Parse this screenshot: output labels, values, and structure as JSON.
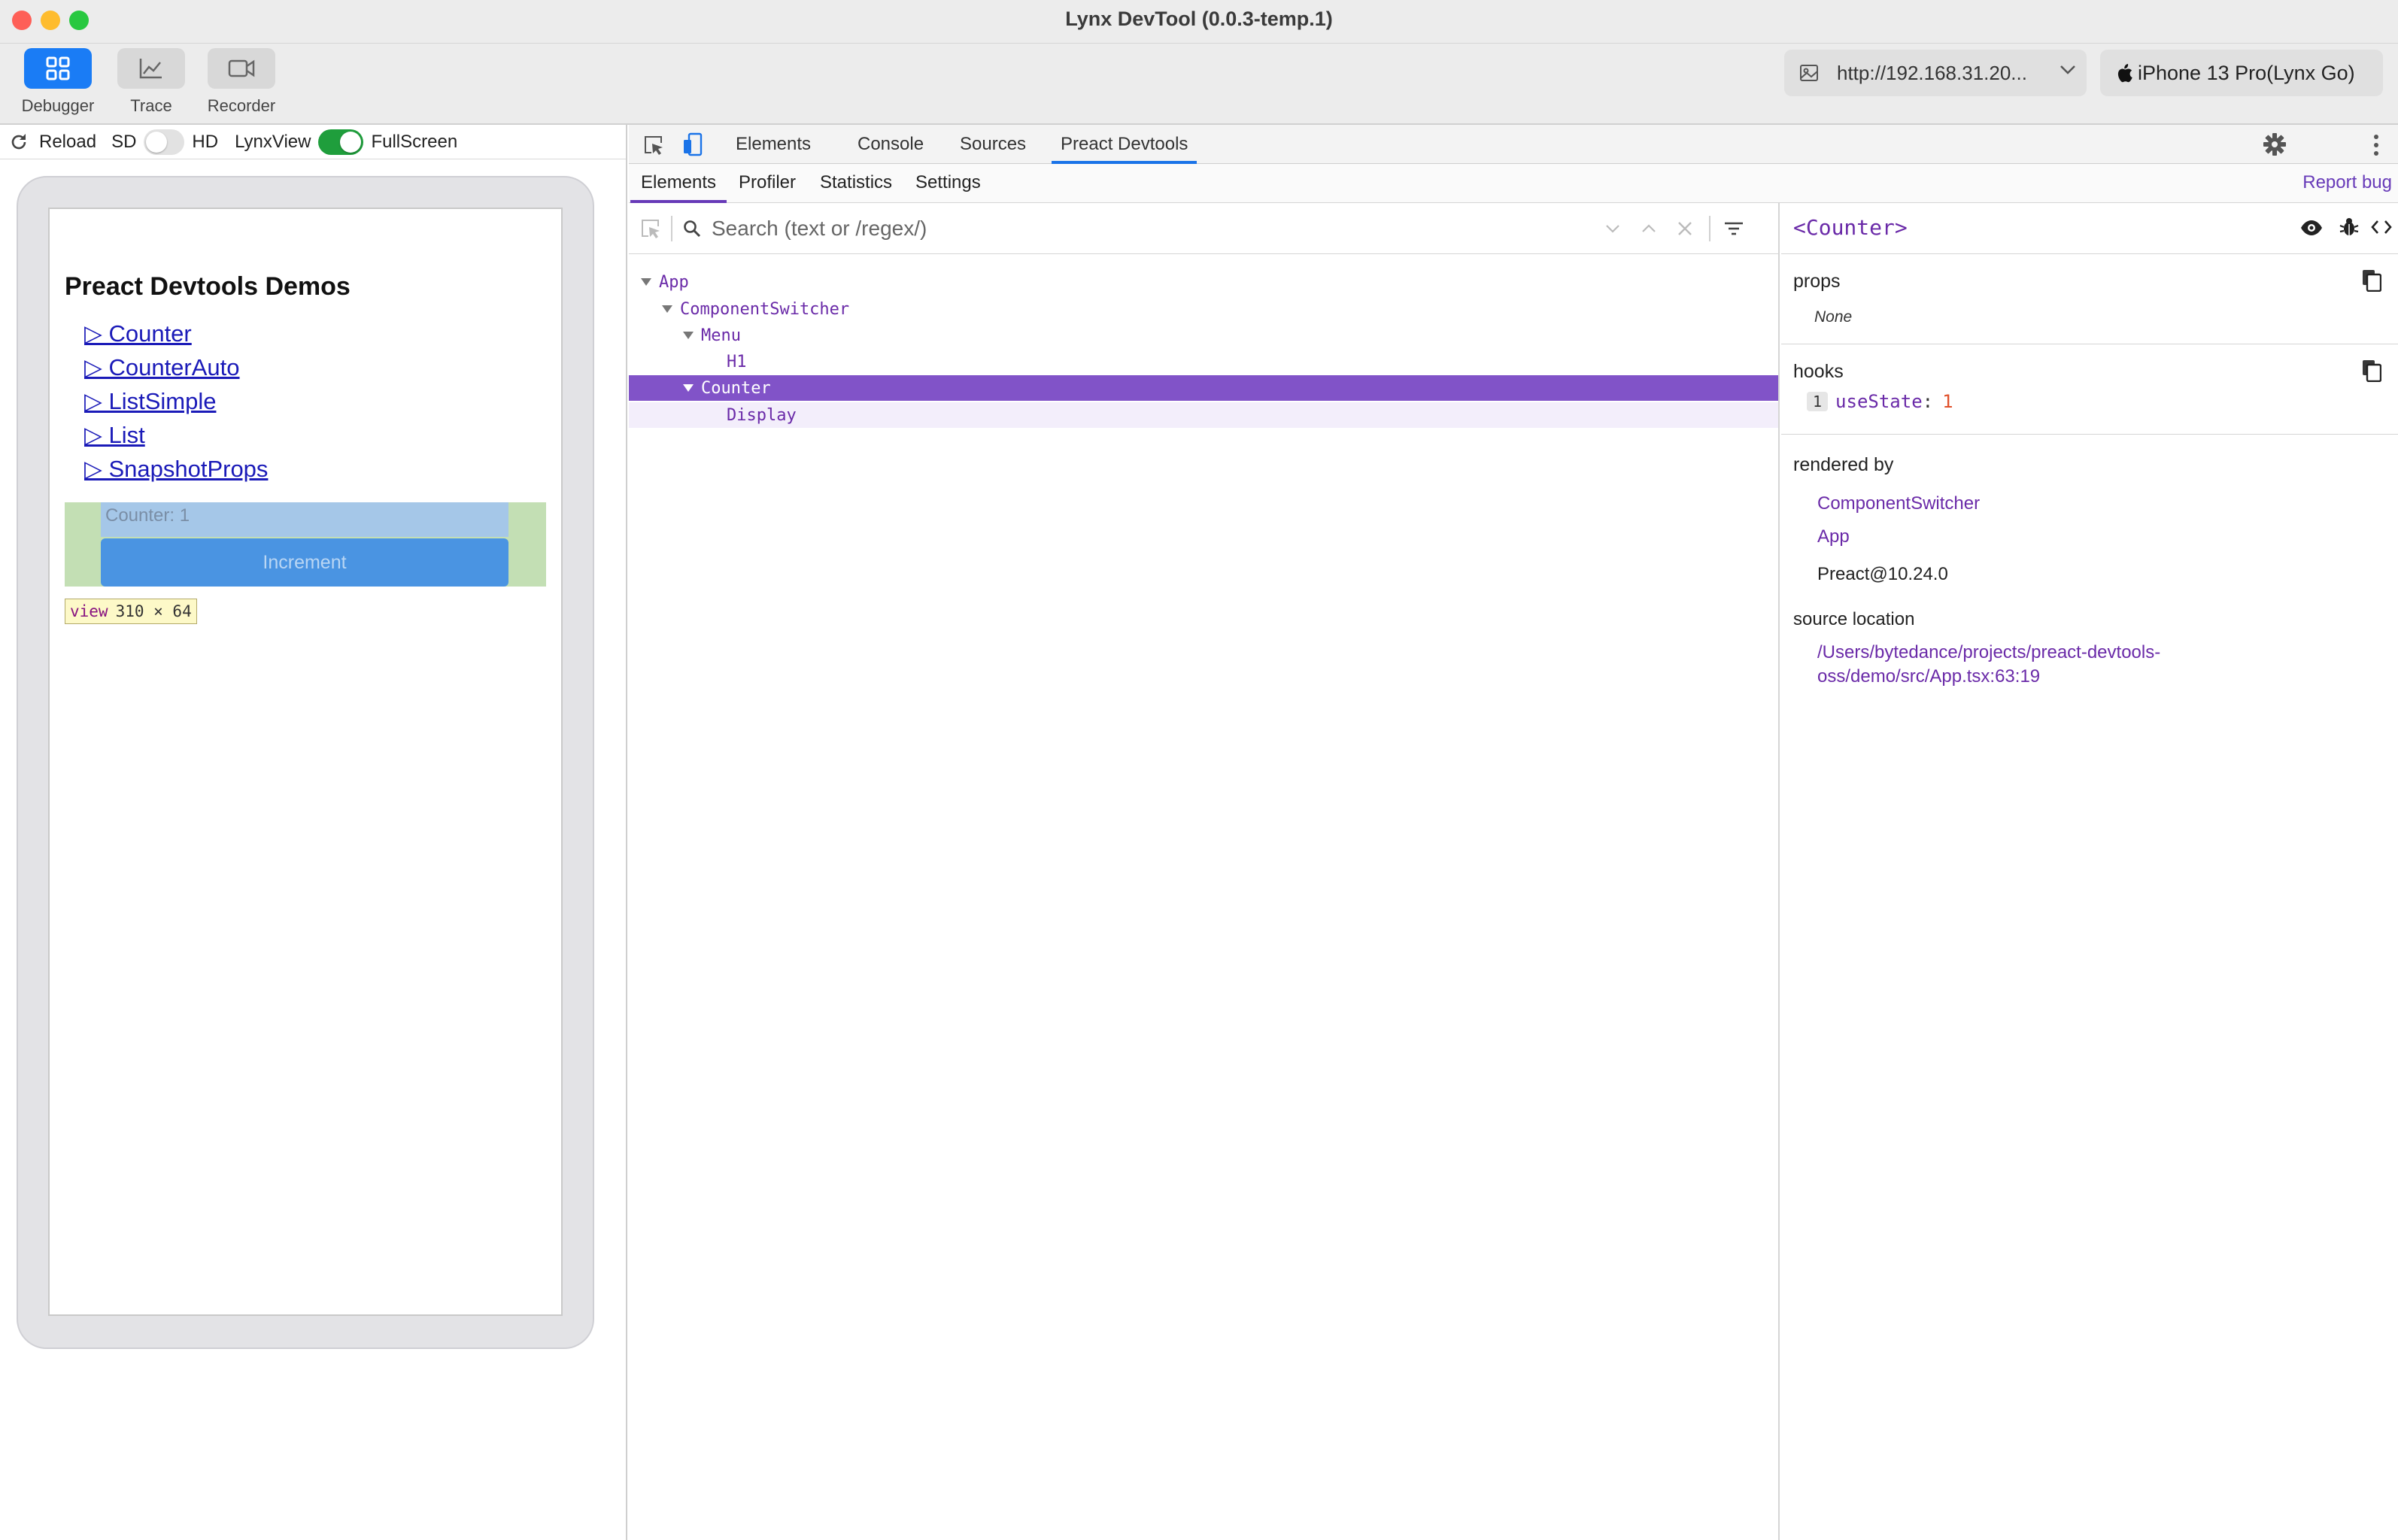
{
  "window": {
    "title": "Lynx DevTool (0.0.3-temp.1)"
  },
  "toolbar": {
    "tools": [
      {
        "label": "Debugger"
      },
      {
        "label": "Trace"
      },
      {
        "label": "Recorder"
      }
    ],
    "url": "http://192.168.31.20...",
    "device": "iPhone 13 Pro(Lynx Go)"
  },
  "preview_bar": {
    "reload": "Reload",
    "sd": "SD",
    "hd": "HD",
    "lynxview": "LynxView",
    "fullscreen": "FullScreen"
  },
  "phone": {
    "title": "Preact Devtools Demos",
    "links": [
      "▷ Counter",
      "▷ CounterAuto",
      "▷ ListSimple",
      "▷ List",
      "▷ SnapshotProps"
    ],
    "counter_label": "Counter: 1",
    "increment": "Increment",
    "size_tip_tag": "view",
    "size_tip_dims": "310 × 64"
  },
  "devtools": {
    "tabs": [
      "Elements",
      "Console",
      "Sources",
      "Preact Devtools"
    ],
    "active_tab": "Preact Devtools",
    "subtabs": [
      "Elements",
      "Profiler",
      "Statistics",
      "Settings"
    ],
    "report_bug": "Report bug",
    "search_placeholder": "Search (text or /regex/)",
    "tree": [
      {
        "name": "App"
      },
      {
        "name": "ComponentSwitcher"
      },
      {
        "name": "Menu"
      },
      {
        "name": "H1"
      },
      {
        "name": "Counter"
      },
      {
        "name": "Display"
      }
    ],
    "details": {
      "component": "<Counter>",
      "props_title": "props",
      "props_none": "None",
      "hooks_title": "hooks",
      "hook_index": "1",
      "hook_name": "useState",
      "hook_colon": ":",
      "hook_value": "1",
      "rendered_by_title": "rendered by",
      "rendered_by": [
        "ComponentSwitcher",
        "App"
      ],
      "preact_version": "Preact@10.24.0",
      "source_title": "source location",
      "source_line1": "/Users/bytedance/projects/preact-devtools-",
      "source_line2": "oss/demo/src/App.tsx:63:19"
    }
  },
  "colors": {
    "accent_blue": "#1a7cf5",
    "preact_purple": "#673ab8",
    "selected_row": "#8153c8",
    "toggle_on": "#1f9e3c"
  }
}
